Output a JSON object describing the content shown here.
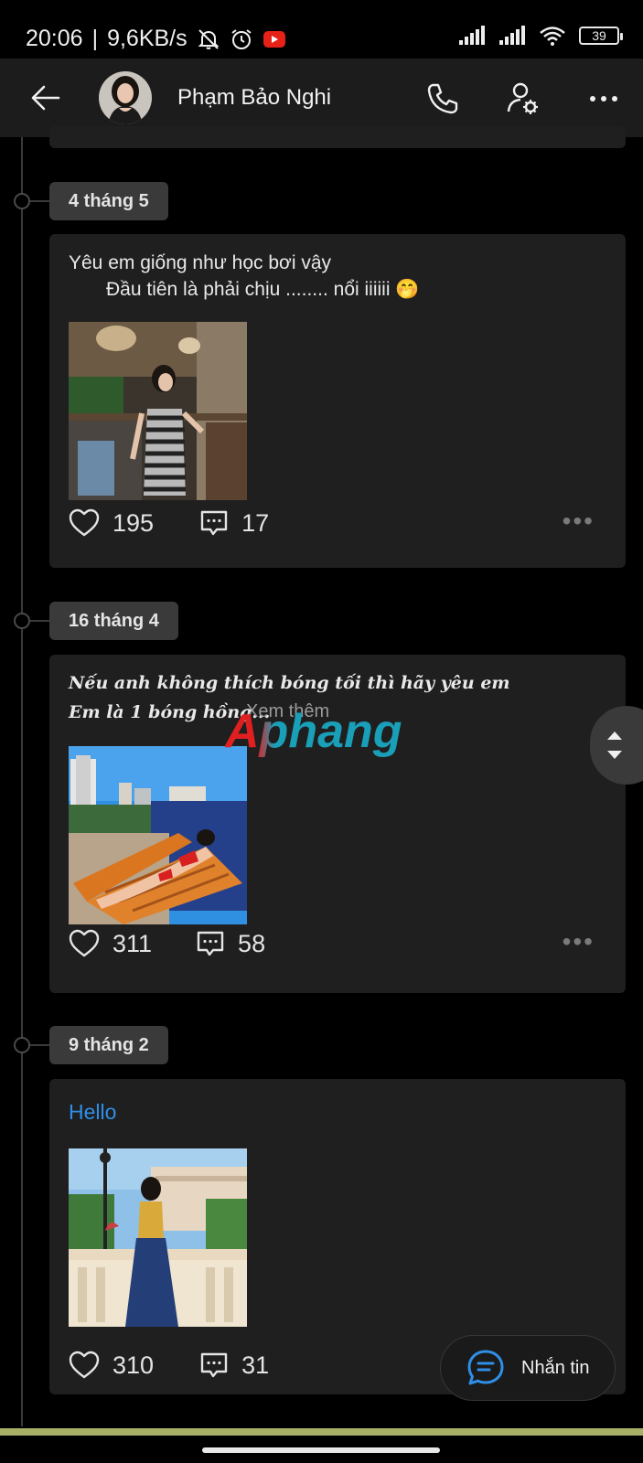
{
  "status_bar": {
    "time": "20:06",
    "speed": "9,6KB/s",
    "battery": "39",
    "icons": [
      "mute-bell-icon",
      "alarm-icon",
      "youtube-icon",
      "signal-icon",
      "signal-icon",
      "wifi-icon",
      "battery-icon"
    ]
  },
  "header": {
    "title": "Phạm Bảo Nghi",
    "icons": [
      "back-arrow-icon",
      "phone-icon",
      "user-settings-icon",
      "more-icon"
    ]
  },
  "posts": [
    {
      "date": "4 tháng 5",
      "text_line1": "Yêu em giống như học bơi vậy",
      "text_line2": "Đầu tiên là phải chịu ........ nổi iiiiii 🤭",
      "likes": "195",
      "comments": "17"
    },
    {
      "date": "16 tháng 4",
      "text_line1": "Nếu anh không thích bóng tối thì hãy yêu em",
      "text_line2": "Em là 1 bóng hồng...",
      "see_more": "Xem thêm",
      "likes": "311",
      "comments": "58"
    },
    {
      "date": "9 tháng 2",
      "text_line1": "Hello",
      "likes": "310",
      "comments": "31"
    }
  ],
  "watermark": "Aphang",
  "fab": {
    "label": "Nhắn tin"
  },
  "colors": {
    "background": "#000000",
    "card": "#1f1f1f",
    "chip": "#3a3a3a",
    "accent_blue": "#2f8fe8",
    "watermark_red": "#e02020",
    "watermark_teal": "#1a9fb8"
  }
}
